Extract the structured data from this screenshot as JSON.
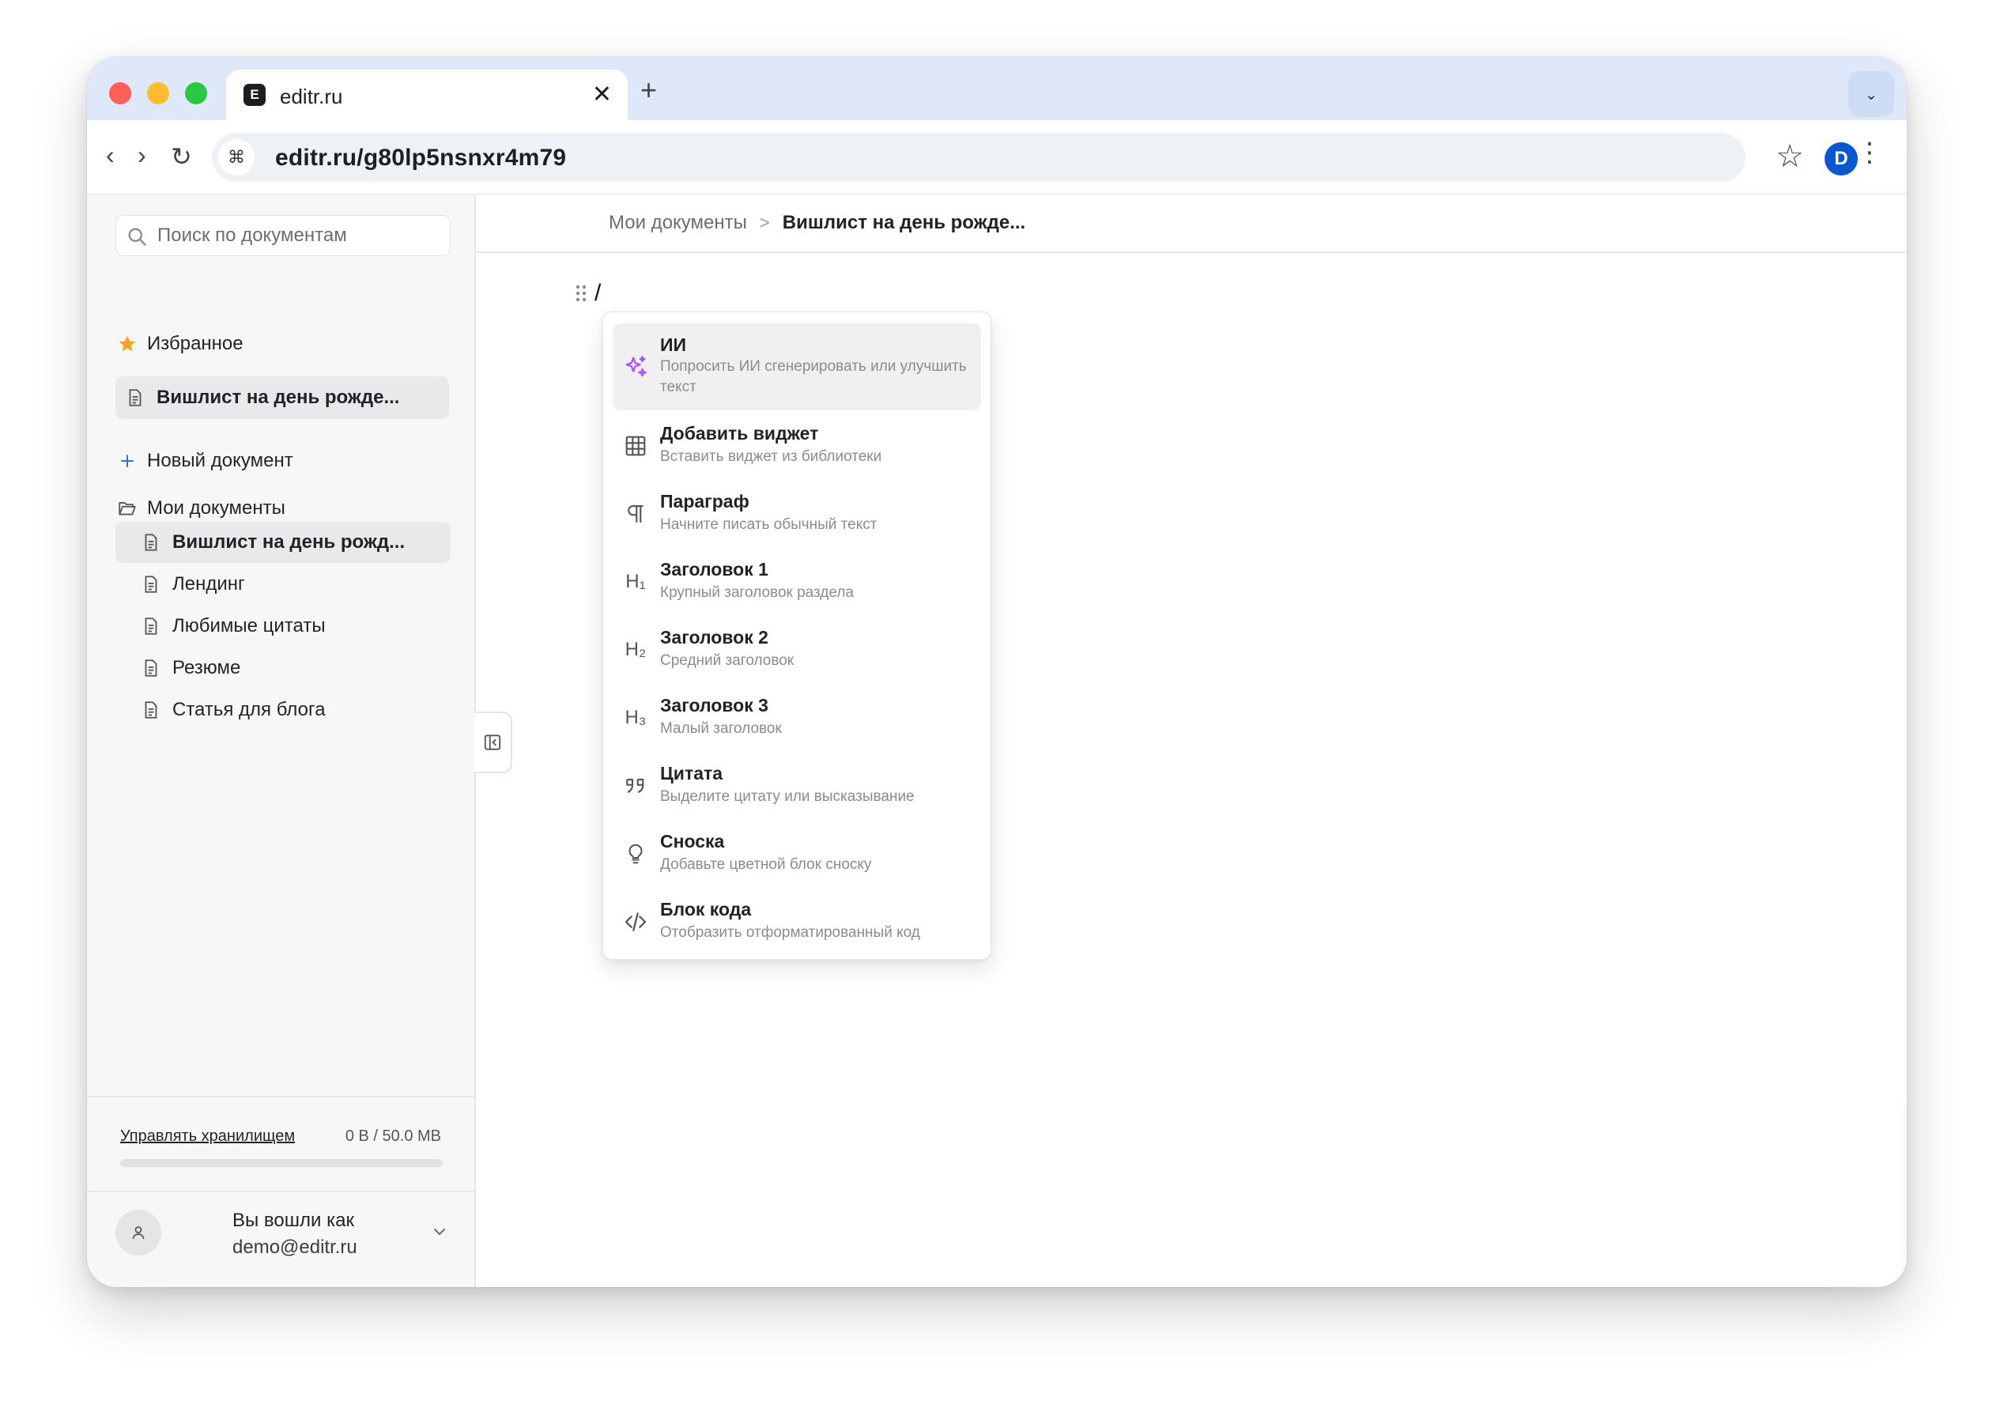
{
  "browser": {
    "tab_favicon": "E",
    "tab_title": "editr.ru",
    "close_glyph": "✕",
    "new_tab_glyph": "+",
    "tab_list_glyph": "⌄",
    "back_glyph": "‹",
    "forward_glyph": "›",
    "reload_glyph": "↻",
    "site_icon_glyph": "⌘",
    "url": "editr.ru/g80lp5nsnxr4m79",
    "bookmark_glyph": "☆",
    "profile_initial": "D",
    "menu_glyph": "⋮"
  },
  "sidebar": {
    "search_placeholder": "Поиск по документам",
    "favorites_label": "Избранное",
    "favorites": [
      {
        "label": "Вишлист на день рожде..."
      }
    ],
    "new_document_label": "Новый документ",
    "my_documents_label": "Мои документы",
    "documents": [
      {
        "label": "Вишлист на день рожд...",
        "active": true
      },
      {
        "label": "Лендинг"
      },
      {
        "label": "Любимые цитаты"
      },
      {
        "label": "Резюме"
      },
      {
        "label": "Статья для блога"
      }
    ],
    "storage": {
      "manage_label": "Управлять хранилищем",
      "usage": "0 B / 50.0 MB",
      "used_fraction": 0
    },
    "user": {
      "line1": "Вы вошли как",
      "email": "demo@editr.ru"
    }
  },
  "main": {
    "breadcrumb": {
      "root": "Мои документы",
      "separator": ">",
      "current": "Вишлист на день рожде..."
    },
    "editor_text": "/",
    "slash_menu": [
      {
        "icon": "sparkles-icon",
        "title": "ИИ",
        "desc": "Попросить ИИ сгенерировать или улучшить текст",
        "highlighted": true
      },
      {
        "icon": "table-icon",
        "title": "Добавить виджет",
        "desc": "Вставить виджет из библиотеки"
      },
      {
        "icon": "pilcrow-icon",
        "title": "Параграф",
        "desc": "Начните писать обычный текст"
      },
      {
        "icon": "heading-1-icon",
        "title": "Заголовок 1",
        "desc": "Крупный заголовок раздела"
      },
      {
        "icon": "heading-2-icon",
        "title": "Заголовок 2",
        "desc": "Средний заголовок"
      },
      {
        "icon": "heading-3-icon",
        "title": "Заголовок 3",
        "desc": "Малый заголовок"
      },
      {
        "icon": "quote-icon",
        "title": "Цитата",
        "desc": "Выделите цитату или высказывание"
      },
      {
        "icon": "lightbulb-icon",
        "title": "Сноска",
        "desc": "Добавьте цветной блок сноску"
      },
      {
        "icon": "code-icon",
        "title": "Блок кода",
        "desc": "Отобразить отформатированный код"
      }
    ],
    "heading_icon_labels": {
      "h1": "H₁",
      "h2": "H₂",
      "h3": "H₃"
    }
  },
  "colors": {
    "accent_purple": "#a855f7",
    "accent_blue": "#2f6fed",
    "star_yellow": "#f5a623",
    "profile_blue": "#0b57d0"
  }
}
